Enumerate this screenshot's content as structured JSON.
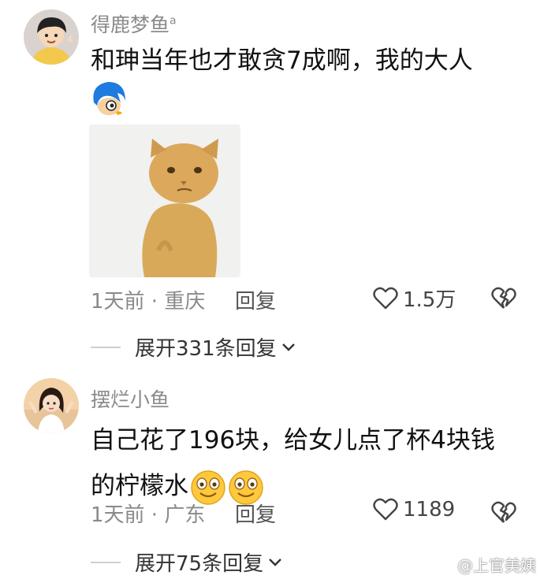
{
  "comments": [
    {
      "username": "得鹿梦鱼",
      "username_suffix": "a",
      "text_lines": [
        "和珅当年也才敢贪7成啊，我的大人"
      ],
      "time_location": "1天前 · 重庆",
      "reply_label": "回复",
      "likes": "1.5万",
      "expand_label": "展开331条回复"
    },
    {
      "username": "摆烂小鱼",
      "text_lines": [
        "自己花了196块，给女儿点了杯4块钱",
        "的柠檬水"
      ],
      "time_location": "1天前 · 广东",
      "reply_label": "回复",
      "likes": "1189",
      "expand_label": "展开75条回复"
    }
  ],
  "watermark": "@上官美姨",
  "colors": {
    "meta_gray": "#8a8a8a",
    "divider": "#cfcfcf",
    "emoji_yellow": "#FFC83D"
  },
  "icons": [
    "heart-outline-icon",
    "broken-heart-icon",
    "chevron-down-icon",
    "weibo-logo-icon",
    "smiley-emoji-icon",
    "blue-hair-sticker-icon"
  ]
}
